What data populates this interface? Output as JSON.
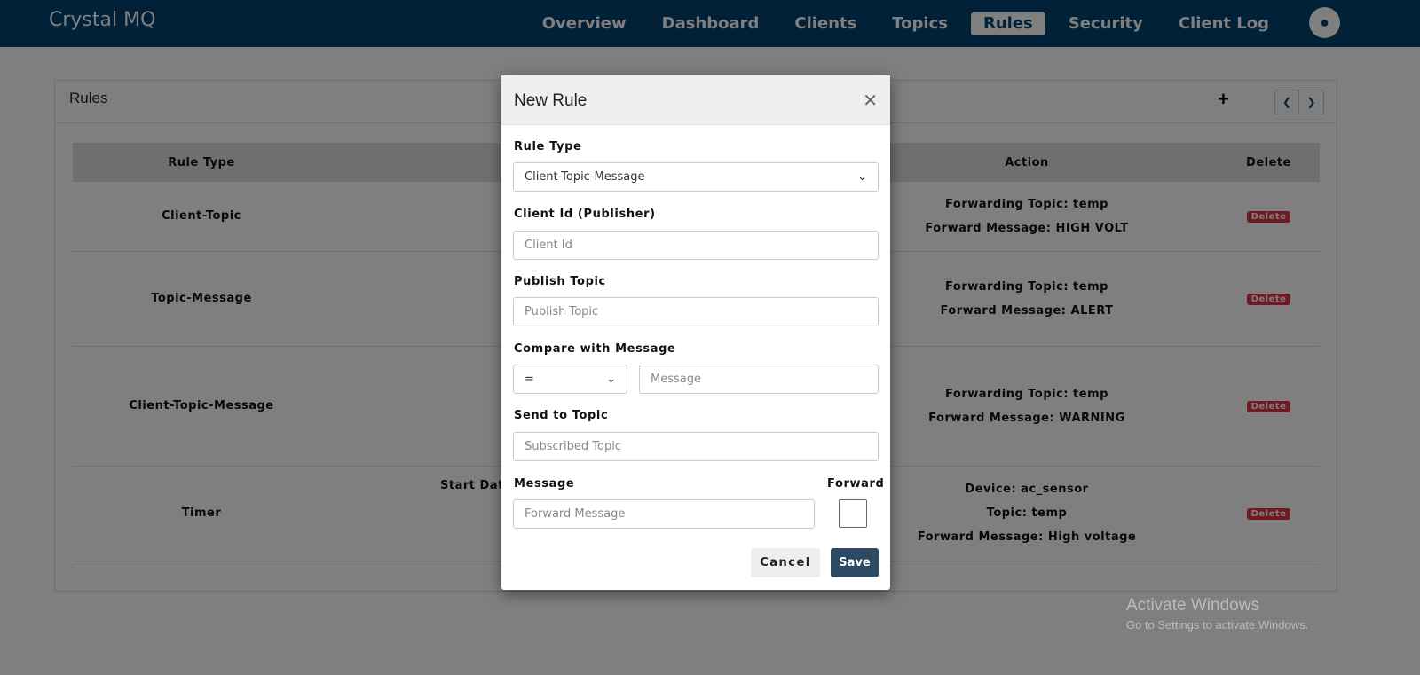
{
  "nav": {
    "logo": "Crystal MQ",
    "items": [
      "Overview",
      "Dashboard",
      "Clients",
      "Topics",
      "Rules",
      "Security",
      "Client Log"
    ],
    "active": "Rules"
  },
  "card": {
    "title": "Rules"
  },
  "table": {
    "headers": [
      "Rule Type",
      "",
      "Action",
      "Delete"
    ],
    "rows": [
      {
        "type": "Client-Topic",
        "condition": "",
        "action": [
          "Forwarding Topic: temp",
          "Forward Message: HIGH VOLT"
        ],
        "delete": "Delete"
      },
      {
        "type": "Topic-Message",
        "condition": "",
        "action": [
          "Forwarding Topic: temp",
          "Forward Message: ALERT"
        ],
        "delete": "Delete"
      },
      {
        "type": "Client-Topic-Message",
        "condition": "",
        "action": [
          "Forwarding Topic: temp",
          "Forward Message: WARNING"
        ],
        "delete": "Delete"
      },
      {
        "type": "Timer",
        "condition": "Start Dat",
        "action": [
          "Device: ac_sensor",
          "Topic: temp",
          "Forward Message: High voltage"
        ],
        "delete": "Delete"
      }
    ]
  },
  "modal": {
    "title": "New Rule",
    "rule_type_label": "Rule Type",
    "rule_type_value": "Client-Topic-Message",
    "client_label": "Client Id (Publisher)",
    "client_ph": "Client Id",
    "publish_label": "Publish Topic",
    "publish_ph": "Publish Topic",
    "compare_label": "Compare with Message",
    "compare_op": "=",
    "message_ph": "Message",
    "send_label": "Send to Topic",
    "send_ph": "Subscribed Topic",
    "msg_label": "Message",
    "msg_ph": "Forward Message",
    "forward_label": "Forward",
    "forward_checked": false,
    "cancel": "Cancel",
    "save": "Save"
  },
  "watermark": {
    "line1": "Activate Windows",
    "line2": "Go to Settings to activate Windows."
  },
  "colors": {
    "navbar": "#00426f",
    "delete": "#dc3545",
    "save": "#2c4a63"
  }
}
